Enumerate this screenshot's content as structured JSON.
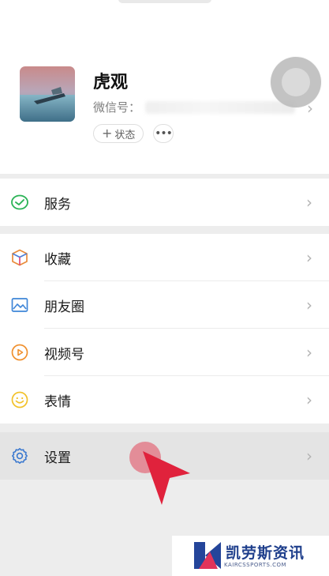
{
  "profile": {
    "nickname": "虎观",
    "wechat_id_label": "微信号：",
    "status_label": "状态",
    "status_plus": "+",
    "more_label": "•••",
    "chevron": "›"
  },
  "menu": {
    "service": {
      "label": "服务",
      "icon": "wechat-pay-check-icon",
      "color": "#2bb356"
    },
    "items": [
      {
        "label": "收藏",
        "icon": "cube-icon"
      },
      {
        "label": "朋友圈",
        "icon": "photo-icon"
      },
      {
        "label": "视频号",
        "icon": "video-channel-icon"
      },
      {
        "label": "表情",
        "icon": "smiley-icon"
      }
    ],
    "settings": {
      "label": "设置",
      "icon": "gear-icon"
    },
    "chevron": "›"
  },
  "watermark": {
    "name": "凯劳斯资讯",
    "sub": "KAIRCSSPORTS.COM"
  },
  "colors": {
    "accent_cursor": "#e2334d",
    "page_bg": "#ededed",
    "cell_bg": "#ffffff"
  }
}
